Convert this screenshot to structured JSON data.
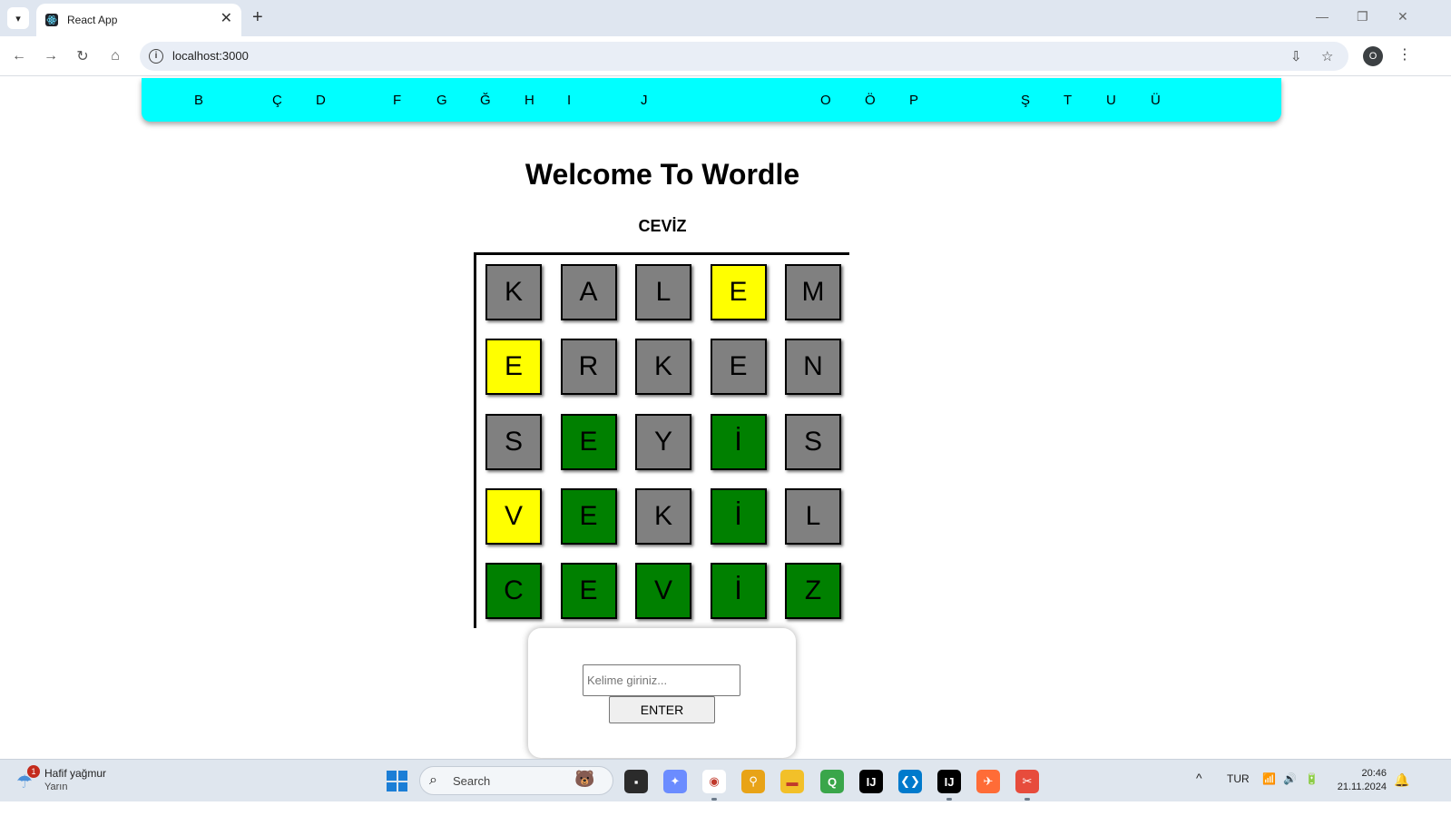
{
  "browser": {
    "tab_title": "React App",
    "url": "localhost:3000",
    "profile_initial": "O"
  },
  "letters": [
    "B",
    "Ç",
    "D",
    "F",
    "G",
    "Ğ",
    "H",
    "I",
    "J",
    "O",
    "Ö",
    "P",
    "Ş",
    "T",
    "U",
    "Ü"
  ],
  "page": {
    "title": "Welcome To Wordle",
    "answer": "CEVİZ"
  },
  "colors": {
    "gray": "#808080",
    "yellow": "#ffff00",
    "green": "#008000",
    "letterbar": "#00ffff"
  },
  "grid": [
    [
      {
        "l": "K",
        "c": "gray"
      },
      {
        "l": "A",
        "c": "gray"
      },
      {
        "l": "L",
        "c": "gray"
      },
      {
        "l": "E",
        "c": "yellow"
      },
      {
        "l": "M",
        "c": "gray"
      }
    ],
    [
      {
        "l": "E",
        "c": "yellow"
      },
      {
        "l": "R",
        "c": "gray"
      },
      {
        "l": "K",
        "c": "gray"
      },
      {
        "l": "E",
        "c": "gray"
      },
      {
        "l": "N",
        "c": "gray"
      }
    ],
    [
      {
        "l": "S",
        "c": "gray"
      },
      {
        "l": "E",
        "c": "green"
      },
      {
        "l": "Y",
        "c": "gray"
      },
      {
        "l": "İ",
        "c": "green"
      },
      {
        "l": "S",
        "c": "gray"
      }
    ],
    [
      {
        "l": "V",
        "c": "yellow"
      },
      {
        "l": "E",
        "c": "green"
      },
      {
        "l": "K",
        "c": "gray"
      },
      {
        "l": "İ",
        "c": "green"
      },
      {
        "l": "L",
        "c": "gray"
      }
    ],
    [
      {
        "l": "C",
        "c": "green"
      },
      {
        "l": "E",
        "c": "green"
      },
      {
        "l": "V",
        "c": "green"
      },
      {
        "l": "İ",
        "c": "green"
      },
      {
        "l": "Z",
        "c": "green"
      }
    ]
  ],
  "form": {
    "placeholder": "Kelime giriniz...",
    "value": "",
    "button_label": "ENTER"
  },
  "taskbar": {
    "weather_title": "Hafif yağmur",
    "weather_sub": "Yarın",
    "weather_badge": "1",
    "search_label": "Search",
    "language": "TUR",
    "time": "20:46",
    "date": "21.11.2024",
    "apps": [
      "file-explorer-icon",
      "copilot-icon",
      "chrome-icon",
      "magnifier-icon",
      "folder-icon",
      "qgis-icon",
      "jetbrains-icon",
      "vscode-icon",
      "intellij-icon",
      "postman-icon",
      "snipping-tool-icon"
    ]
  }
}
